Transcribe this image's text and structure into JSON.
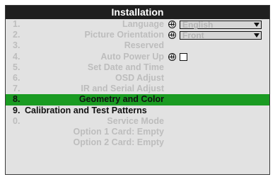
{
  "menu": {
    "title": "Installation",
    "items": [
      {
        "num": "1.",
        "label": "Language",
        "control": "dropdown",
        "value": "English"
      },
      {
        "num": "2.",
        "label": "Picture Orientation",
        "control": "dropdown",
        "value": "Front"
      },
      {
        "num": "3.",
        "label": "Reserved"
      },
      {
        "num": "4.",
        "label": "Auto Power Up",
        "control": "checkbox"
      },
      {
        "num": "5.",
        "label": "Set Date and Time"
      },
      {
        "num": "6.",
        "label": "OSD Adjust"
      },
      {
        "num": "7.",
        "label": "IR and Serial Adjust"
      },
      {
        "num": "8.",
        "label": "Geometry and Color"
      },
      {
        "num": "9.",
        "label": "Calibration and Test Patterns"
      },
      {
        "num": "0.",
        "label": "Service Mode"
      },
      {
        "num": "",
        "label": "Option 1 Card: Empty"
      },
      {
        "num": "",
        "label": "Option 2 Card: Empty"
      }
    ],
    "selected_index": 7
  },
  "colors": {
    "title_bar": "#1f1f1f",
    "panel_bg": "#e2e2e2",
    "selected_bg": "#1a9b22",
    "disabled_text": "#bdbdbd",
    "active_text": "#111111"
  },
  "icons": {
    "setting_marker": "globe-icon",
    "dropdown_arrow": "triangle-down-icon"
  }
}
